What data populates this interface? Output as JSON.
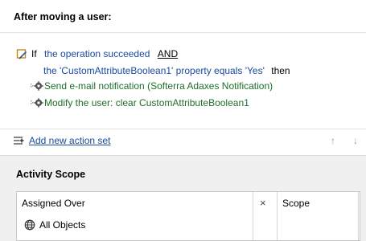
{
  "rule": {
    "title": "After moving a user:",
    "condition": {
      "if_keyword": "If",
      "first": "the operation succeeded",
      "and_keyword": "AND",
      "second": "the 'CustomAttributeBoolean1' property equals 'Yes'",
      "then_keyword": "then"
    },
    "actions": [
      {
        "label": "Send e-mail notification (Softerra Adaxes Notification)"
      },
      {
        "label": "Modify the user: clear CustomAttributeBoolean1"
      }
    ],
    "add_action_set_label": "Add new action set"
  },
  "activity_scope": {
    "title": "Activity Scope",
    "columns": {
      "assigned_over": "Assigned Over",
      "remove": "×",
      "scope": "Scope"
    },
    "rows": [
      {
        "name": "All Objects"
      }
    ]
  }
}
